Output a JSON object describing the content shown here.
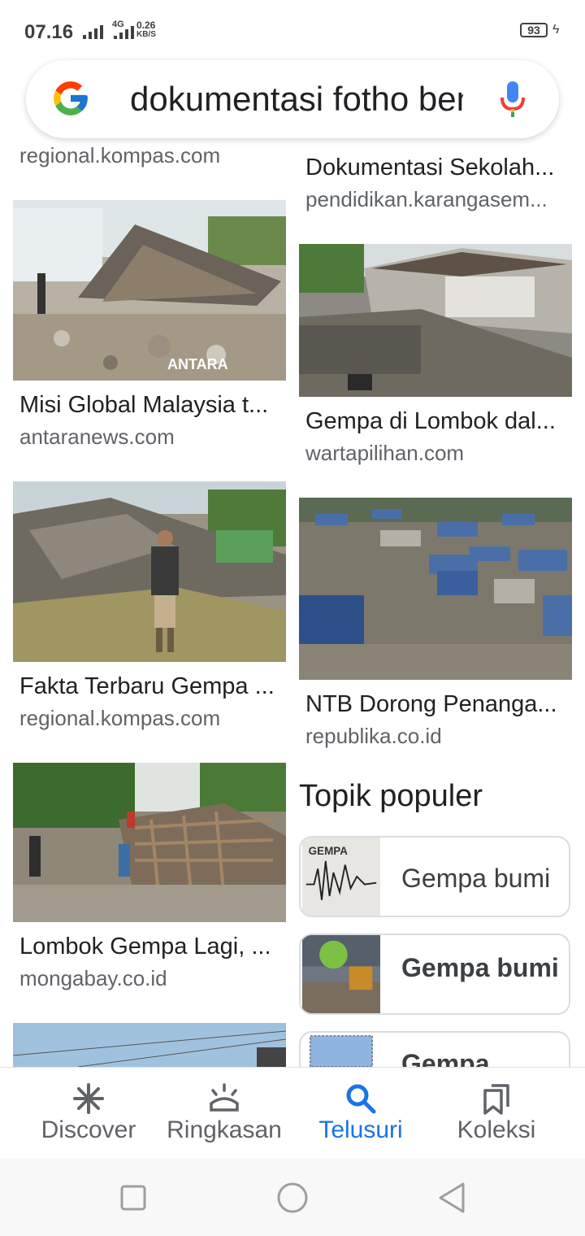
{
  "status_bar": {
    "time": "07.16",
    "network_type": "4G",
    "speed_value": "0.26",
    "speed_unit": "KB/S",
    "battery": "93"
  },
  "search": {
    "query": "dokumentasi fotho bencana"
  },
  "results": {
    "left": [
      {
        "title": "",
        "source": "regional.kompas.com"
      },
      {
        "title": "Misi Global Malaysia t...",
        "source": "antaranews.com",
        "watermark": "ANTARA"
      },
      {
        "title": "Fakta Terbaru Gempa ...",
        "source": "regional.kompas.com"
      },
      {
        "title": "Lombok Gempa Lagi, ...",
        "source": "mongabay.co.id"
      }
    ],
    "right": [
      {
        "title": "Dokumentasi Sekolah...",
        "source": "pendidikan.karangasem..."
      },
      {
        "title": "Gempa di Lombok dal...",
        "source": "wartapilihan.com"
      },
      {
        "title": "NTB Dorong Penanga...",
        "source": "republika.co.id"
      }
    ]
  },
  "topics": {
    "heading": "Topik populer",
    "items": [
      {
        "label": "Gempa bumi",
        "image_text": "GEMPA"
      },
      {
        "label": "Gempa bumi"
      },
      {
        "label": "Gempa"
      }
    ]
  },
  "bottom_nav": {
    "items": [
      {
        "label": "Discover",
        "icon": "asterisk-icon"
      },
      {
        "label": "Ringkasan",
        "icon": "sunrise-icon"
      },
      {
        "label": "Telusuri",
        "icon": "search-icon"
      },
      {
        "label": "Koleksi",
        "icon": "bookmarks-icon"
      }
    ],
    "active_color": "#1a73e8"
  }
}
